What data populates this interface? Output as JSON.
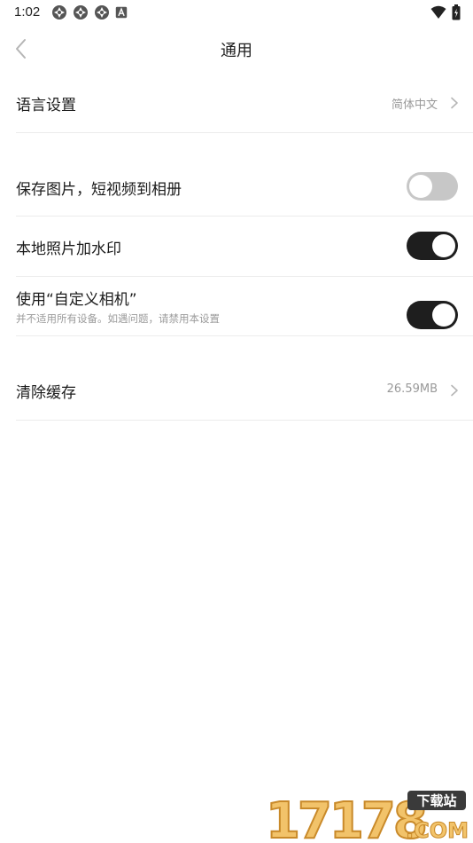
{
  "status_bar": {
    "time": "1:02",
    "icons_left": [
      "app-icon",
      "app-icon",
      "app-icon",
      "a-icon"
    ],
    "icons_right": [
      "wifi-icon",
      "battery-icon"
    ]
  },
  "header": {
    "title": "通用",
    "back_icon": "chevron-left-icon"
  },
  "settings": {
    "language": {
      "label": "语言设置",
      "value": "简体中文"
    },
    "save_media": {
      "label": "保存图片，短视频到相册",
      "enabled": false
    },
    "watermark": {
      "label": "本地照片加水印",
      "enabled": true
    },
    "custom_camera": {
      "label": "使用“自定义相机”",
      "sublabel": "并不适用所有设备。如遇问题，请禁用本设置",
      "enabled": true
    },
    "clear_cache": {
      "label": "清除缓存",
      "value": "26.59MB"
    }
  },
  "watermark_logo": {
    "text": "17178",
    "badge": "下载站",
    "suffix": ".COM"
  },
  "colors": {
    "toggle_on": "#1e1e1e",
    "toggle_off": "#c7c7c7",
    "divider": "#ececec"
  }
}
